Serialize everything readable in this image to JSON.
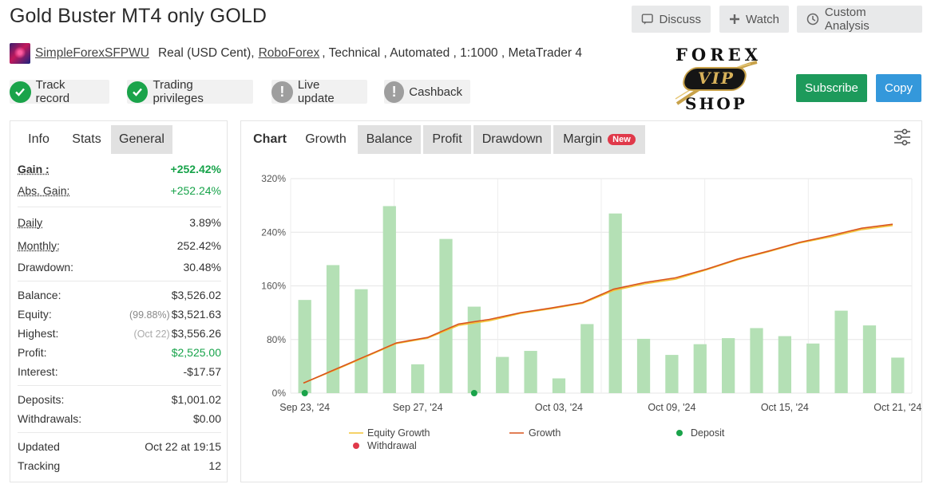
{
  "header": {
    "title": "Gold Buster MT4 only GOLD",
    "discuss_label": "Discuss",
    "watch_label": "Watch",
    "analysis_label": "Custom Analysis"
  },
  "meta": {
    "username": "SimpleForexSFPWU",
    "account_type": "Real (USD Cent),",
    "broker": "RoboForex",
    "details": ", Technical , Automated , 1:1000 , MetaTrader 4"
  },
  "badges": {
    "track_record": "Track record",
    "trading_privileges": "Trading privileges",
    "live_update": "Live update",
    "cashback": "Cashback"
  },
  "logo": {
    "line1": "FOREX",
    "line2": "VIP",
    "line3": "SHOP"
  },
  "actions": {
    "subscribe_label": "Subscribe",
    "copy_label": "Copy"
  },
  "colors": {
    "subscribe": "#1d9a5b",
    "copy": "#3498db",
    "positive": "#17a34a",
    "bar": "#b4e0b5",
    "growth": "#d9541d",
    "equity": "#f2c437",
    "deposit": "#1aa34a",
    "withdrawal": "#e0394a"
  },
  "left_tabs": {
    "info": "Info",
    "stats": "Stats",
    "general": "General"
  },
  "stats": {
    "gain_label": "Gain :",
    "gain": "+252.42%",
    "abs_gain_label": "Abs. Gain:",
    "abs_gain": "+252.24%",
    "daily_label": "Daily",
    "daily": "3.89%",
    "monthly_label": "Monthly:",
    "monthly": "252.42%",
    "drawdown_label": "Drawdown:",
    "drawdown": "30.48%",
    "balance_label": "Balance:",
    "balance": "$3,526.02",
    "equity_label": "Equity:",
    "equity_pct": "(99.88%)",
    "equity": "$3,521.63",
    "highest_label": "Highest:",
    "highest_date": "(Oct 22)",
    "highest": "$3,556.26",
    "profit_label": "Profit:",
    "profit": "$2,525.00",
    "interest_label": "Interest:",
    "interest": "-$17.57",
    "deposits_label": "Deposits:",
    "deposits": "$1,001.02",
    "withdrawals_label": "Withdrawals:",
    "withdrawals": "$0.00",
    "updated_label": "Updated",
    "updated": "Oct 22 at 19:15",
    "tracking_label": "Tracking",
    "tracking": "12"
  },
  "chart_tabs": {
    "chart": "Chart",
    "growth": "Growth",
    "balance": "Balance",
    "profit": "Profit",
    "drawdown": "Drawdown",
    "margin": "Margin",
    "new_badge": "New"
  },
  "chart_data": {
    "type": "bar",
    "y_ticks": [
      "320%",
      "240%",
      "160%",
      "80%",
      "0%"
    ],
    "ylim": [
      0,
      320
    ],
    "x_tick_labels": [
      "Sep 23, '24",
      "Sep 27, '24",
      "Oct 03, '24",
      "Oct 09, '24",
      "Oct 15, '24",
      "Oct 21, '24"
    ],
    "x_tick_positions": [
      0,
      4,
      9,
      13,
      17,
      21
    ],
    "grid": true,
    "legend": [
      "Equity Growth",
      "Growth",
      "Deposit",
      "Withdrawal"
    ],
    "bars": [
      139,
      191,
      155,
      279,
      43,
      230,
      129,
      54,
      63,
      22,
      103,
      268,
      81,
      57,
      73,
      82,
      97,
      85,
      74,
      123,
      101,
      53
    ],
    "growth_line": [
      [
        0,
        15
      ],
      [
        1,
        35
      ],
      [
        2,
        55
      ],
      [
        3,
        75
      ],
      [
        4,
        83
      ],
      [
        5,
        103
      ],
      [
        6,
        110
      ],
      [
        7,
        120
      ],
      [
        8,
        127
      ],
      [
        9,
        135
      ],
      [
        10,
        155
      ],
      [
        11,
        165
      ],
      [
        12,
        172
      ],
      [
        13,
        185
      ],
      [
        14,
        200
      ],
      [
        15,
        212
      ],
      [
        16,
        225
      ],
      [
        17,
        235
      ],
      [
        18,
        246
      ],
      [
        19,
        252
      ]
    ],
    "equity_line": [
      [
        0,
        15
      ],
      [
        1,
        34
      ],
      [
        2,
        54
      ],
      [
        3,
        74
      ],
      [
        4,
        82
      ],
      [
        5,
        101
      ],
      [
        6,
        108
      ],
      [
        7,
        119
      ],
      [
        8,
        126
      ],
      [
        9,
        134
      ],
      [
        10,
        153
      ],
      [
        11,
        163
      ],
      [
        12,
        170
      ],
      [
        13,
        184
      ],
      [
        14,
        199
      ],
      [
        15,
        211
      ],
      [
        16,
        224
      ],
      [
        17,
        233
      ],
      [
        18,
        244
      ],
      [
        19,
        250
      ]
    ],
    "deposits_at": [
      0,
      6
    ]
  }
}
